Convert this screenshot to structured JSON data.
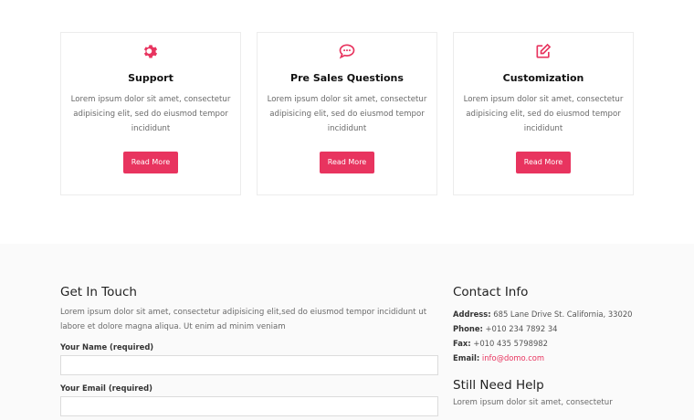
{
  "cards": [
    {
      "icon": "gear-icon",
      "title": "Support",
      "body": "Lorem ipsum dolor sit amet, consectetur adipisicing elit, sed do eiusmod tempor incididunt",
      "button": "Read More"
    },
    {
      "icon": "chat-bubble-icon",
      "title": "Pre Sales Questions",
      "body": "Lorem ipsum dolor sit amet, consectetur adipisicing elit, sed do eiusmod tempor incididunt",
      "button": "Read More"
    },
    {
      "icon": "edit-icon",
      "title": "Customization",
      "body": "Lorem ipsum dolor sit amet, consectetur adipisicing elit, sed do eiusmod tempor incididunt",
      "button": "Read More"
    }
  ],
  "get_in_touch": {
    "title": "Get In Touch",
    "description": "Lorem ipsum dolor sit amet, consectetur adipisicing elit,sed do eiusmod tempor incididunt ut labore et dolore magna aliqua. Ut enim ad minim veniam",
    "name_label": "Your Name (required)",
    "email_label": "Your Email (required)"
  },
  "contact_info": {
    "title": "Contact Info",
    "address_label": "Address:",
    "address": "685 Lane Drive St. California, 33020",
    "phone_label": "Phone:",
    "phone": "+010 234 7892 34",
    "fax_label": "Fax:",
    "fax": "+010 435 5798982",
    "email_label": "Email:",
    "email": "info@domo.com"
  },
  "still_need_help": {
    "title": "Still Need Help",
    "text": "Lorem ipsum dolor sit amet, consectetur"
  },
  "colors": {
    "accent": "#e8345f",
    "footer_bg": "#fafafa"
  }
}
